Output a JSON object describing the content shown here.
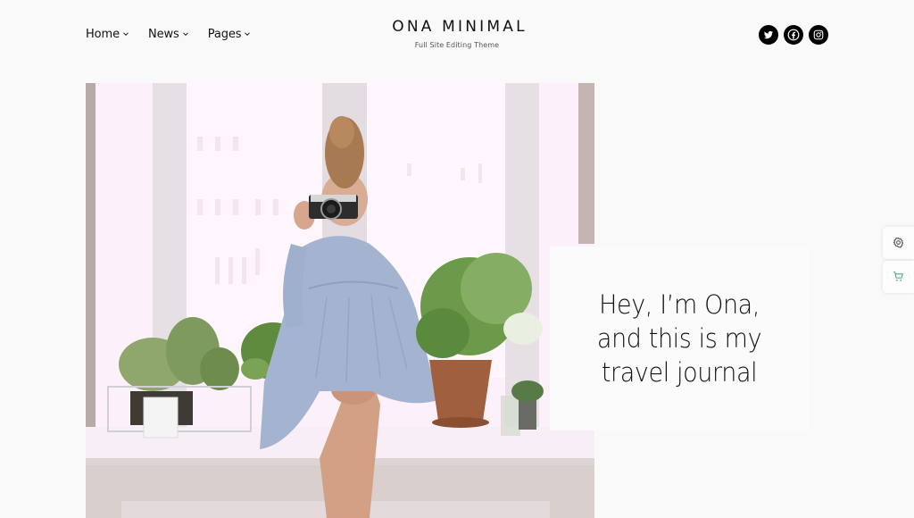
{
  "header": {
    "nav": [
      {
        "label": "Home",
        "has_dropdown": true
      },
      {
        "label": "News",
        "has_dropdown": true
      },
      {
        "label": "Pages",
        "has_dropdown": true
      }
    ],
    "site_title": "ONA MINIMAL",
    "tagline": "Full Site Editing Theme",
    "social": [
      {
        "name": "twitter-icon"
      },
      {
        "name": "facebook-icon"
      },
      {
        "name": "instagram-icon"
      }
    ]
  },
  "hero": {
    "image_alt": "Woman in blue dress sitting on a windowsill holding a camera, surrounded by potted plants",
    "heading_lines": [
      "Hey, I’m Ona,",
      "and this is my",
      "travel journal"
    ]
  },
  "side_widgets": [
    {
      "name": "settings",
      "icon": "gear-icon",
      "color": "#555555"
    },
    {
      "name": "cart",
      "icon": "cart-icon",
      "color": "#3cb371"
    }
  ],
  "colors": {
    "background": "#f9f9f9",
    "text": "#111111",
    "social_bg": "#000000",
    "cart_accent": "#3cb371"
  }
}
